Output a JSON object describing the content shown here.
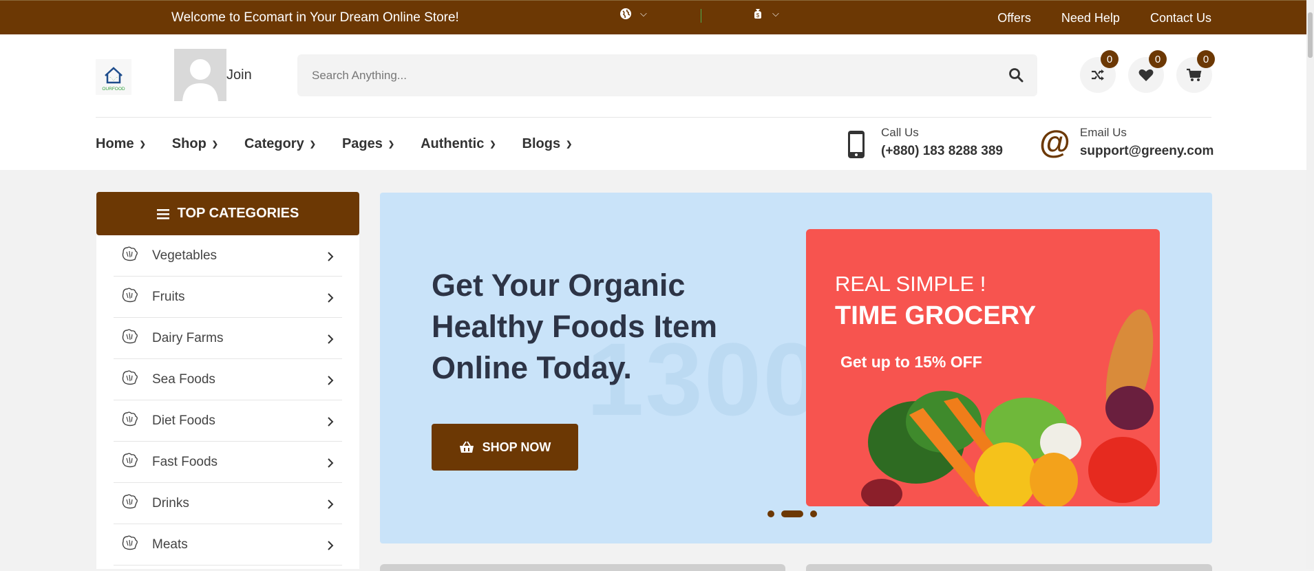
{
  "topbar": {
    "welcome": "Welcome to Ecomart in Your Dream Online Store!",
    "links": [
      "Offers",
      "Need Help",
      "Contact Us"
    ]
  },
  "header": {
    "logo_text": "OURFOOD",
    "join": "Join",
    "search_placeholder": "Search Anything...",
    "compare_count": "0",
    "wishlist_count": "0",
    "cart_count": "0"
  },
  "nav": {
    "items": [
      "Home",
      "Shop",
      "Category",
      "Pages",
      "Authentic",
      "Blogs"
    ]
  },
  "contact": {
    "call_label": "Call Us",
    "call_value": "(+880) 183 8288 389",
    "email_label": "Email Us",
    "email_value": "support@greeny.com"
  },
  "sidebar": {
    "title": "TOP CATEGORIES",
    "items": [
      "Vegetables",
      "Fruits",
      "Dairy Farms",
      "Sea Foods",
      "Diet Foods",
      "Fast Foods",
      "Drinks",
      "Meats"
    ]
  },
  "banner": {
    "headline": "Get Your Organic Healthy Foods Item Online Today.",
    "watermark": "1300x",
    "button": "SHOP NOW",
    "promo_line1": "REAL SIMPLE !",
    "promo_line2": "TIME GROCERY",
    "promo_line3_prefix": "Get up to ",
    "promo_line3_bold": "15% OFF"
  },
  "colors": {
    "brand": "#6c3804",
    "banner_bg": "#c9e3f9",
    "promo_bg": "#f7544f"
  }
}
